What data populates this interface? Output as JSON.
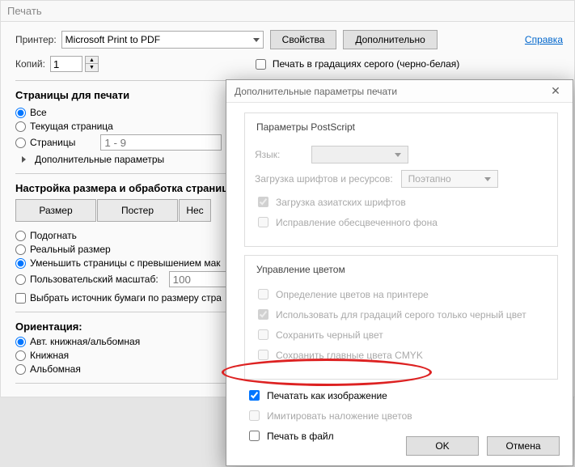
{
  "print": {
    "title": "Печать",
    "printerLabel": "Принтер:",
    "printerName": "Microsoft Print to PDF",
    "propertiesBtn": "Свойства",
    "advancedBtn": "Дополнительно",
    "helpLink": "Справка",
    "copiesLabel": "Копий:",
    "copiesValue": "1",
    "grayscalePartial": "Печать в градациях серого (черно-белая)",
    "pagesSection": "Страницы для печати",
    "pageAll": "Все",
    "pageCurrent": "Текущая страница",
    "pageRange": "Страницы",
    "pageRangePlaceholder": "1 - 9",
    "moreOptions": "Дополнительные параметры",
    "sizingSection": "Настройка размера и обработка страниц",
    "sizeBtn": "Размер",
    "posterBtn": "Постер",
    "multipleBtn": "Нес",
    "fit": "Подогнать",
    "actualSize": "Реальный размер",
    "shrink": "Уменьшить страницы с превышением мак",
    "customScale": "Пользовательский масштаб:",
    "customScaleValue": "100",
    "paperSourceByPage": "Выбрать источник бумаги по размеру стра",
    "orientationSection": "Ориентация:",
    "orientAuto": "Авт. книжная/альбомная",
    "orientPortrait": "Книжная",
    "orientLandscape": "Альбомная"
  },
  "dialog": {
    "title": "Дополнительные параметры печати",
    "psGroup": "Параметры PostScript",
    "langLabel": "Язык:",
    "fontLoadLabel": "Загрузка шрифтов и ресурсов:",
    "fontLoadValue": "Поэтапно",
    "asianFonts": "Загрузка азиатских шрифтов",
    "fixBleached": "Исправление обесцвеченного фона",
    "colorGroup": "Управление цветом",
    "colorPrinter": "Определение цветов на принтере",
    "grayOnlyBlack": "Использовать для градаций серого только черный цвет",
    "preserveBlack": "Сохранить черный цвет",
    "preserveCMYK": "Сохранить главные цвета CMYK",
    "printAsImage": "Печатать как изображение",
    "simulateOverprint": "Имитировать наложение цветов",
    "printToFile": "Печать в файл",
    "okBtn": "OK",
    "cancelBtn": "Отмена"
  }
}
